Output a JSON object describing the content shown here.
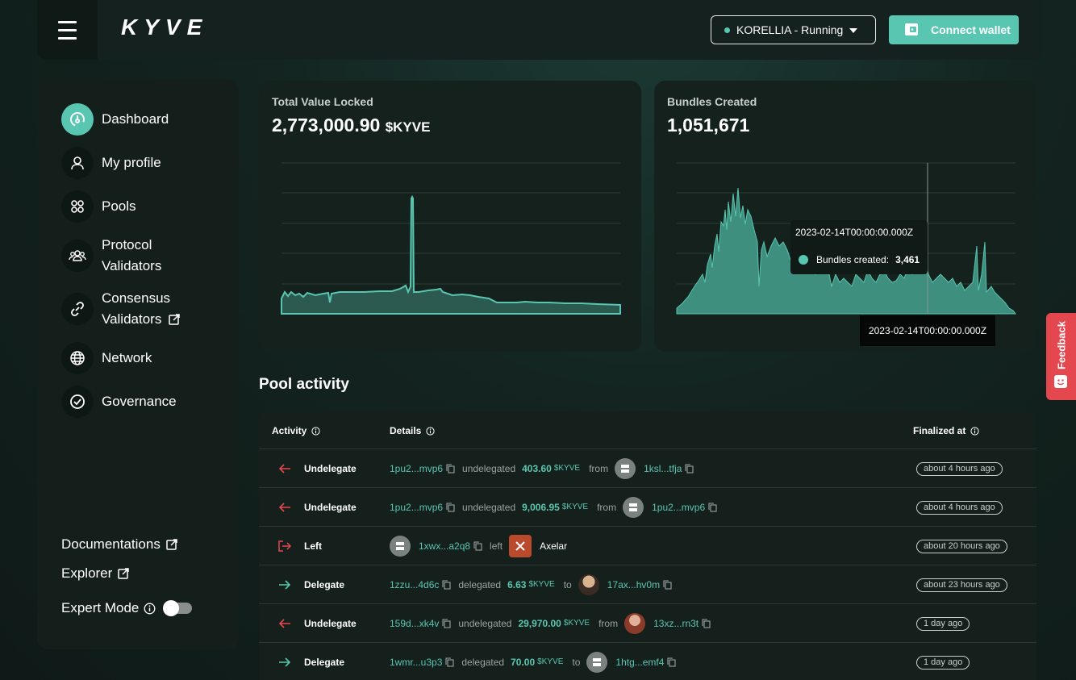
{
  "app": {
    "logo": "KYVE",
    "network_status": "KORELLIA - Running",
    "connect_wallet": "Connect wallet"
  },
  "sidebar": {
    "items": [
      {
        "label": "Dashboard",
        "icon": "dashboard-gauge-icon",
        "active": true
      },
      {
        "label": "My profile",
        "icon": "user-icon"
      },
      {
        "label": "Pools",
        "icon": "pools-grid-icon"
      },
      {
        "label": "Protocol",
        "label2": "Validators",
        "icon": "users-group-icon"
      },
      {
        "label": "Consensus",
        "label2": "Validators",
        "icon": "link-icon",
        "external": true
      },
      {
        "label": "Network",
        "icon": "globe-icon"
      },
      {
        "label": "Governance",
        "icon": "check-circle-icon"
      }
    ],
    "documentation": "Documentations",
    "explorer": "Explorer",
    "expert_mode": "Expert Mode",
    "expert_mode_on": false
  },
  "tvl": {
    "title": "Total Value Locked",
    "value": "2,773,000.90",
    "unit": "$KYVE"
  },
  "bundles": {
    "title": "Bundles Created",
    "value": "1,051,671",
    "tooltip_date": "2023-02-14T00:00:00.000Z",
    "tooltip_label": "Bundles created:",
    "tooltip_value": "3,461",
    "axis_tooltip": "2023-02-14T00:00:00.000Z"
  },
  "feedback": "Feedback",
  "pool_activity": {
    "title": "Pool activity",
    "headers": {
      "activity": "Activity",
      "details": "Details",
      "finalized": "Finalized at"
    },
    "rows": [
      {
        "type": "Undelegate",
        "icon": "arrow-left-icon",
        "from": "1pu2...mvp6",
        "verb": "undelegated",
        "amount": "403.60",
        "unit": "$KYVE",
        "prep": "from",
        "to": "1ksl...tfja",
        "time": "about 4 hours ago"
      },
      {
        "type": "Undelegate",
        "icon": "arrow-left-icon",
        "from": "1pu2...mvp6",
        "verb": "undelegated",
        "amount": "9,006.95",
        "unit": "$KYVE",
        "prep": "from",
        "to": "1pu2...mvp6",
        "time": "about 4 hours ago"
      },
      {
        "type": "Left",
        "icon": "logout-icon",
        "from": "1xwx...a2q8",
        "verb": "left",
        "pool": "Axelar",
        "time": "about 20 hours ago"
      },
      {
        "type": "Delegate",
        "icon": "arrow-right-icon",
        "from": "1zzu...4d6c",
        "verb": "delegated",
        "amount": "6.63",
        "unit": "$KYVE",
        "prep": "to",
        "to": "17ax...hv0m",
        "time": "about 23 hours ago"
      },
      {
        "type": "Undelegate",
        "icon": "arrow-left-icon",
        "from": "159d...xk4v",
        "verb": "undelegated",
        "amount": "29,970.00",
        "unit": "$KYVE",
        "prep": "from",
        "to": "13xz...rn3t",
        "time": "1 day ago"
      },
      {
        "type": "Delegate",
        "icon": "arrow-right-icon",
        "from": "1wmr...u3p3",
        "verb": "delegated",
        "amount": "70.00",
        "unit": "$KYVE",
        "prep": "to",
        "to": "1htg...emf4",
        "time": "1 day ago"
      }
    ]
  },
  "colors": {
    "accent": "#58c6b0",
    "danger": "#e5474f",
    "background": "#13231f"
  }
}
